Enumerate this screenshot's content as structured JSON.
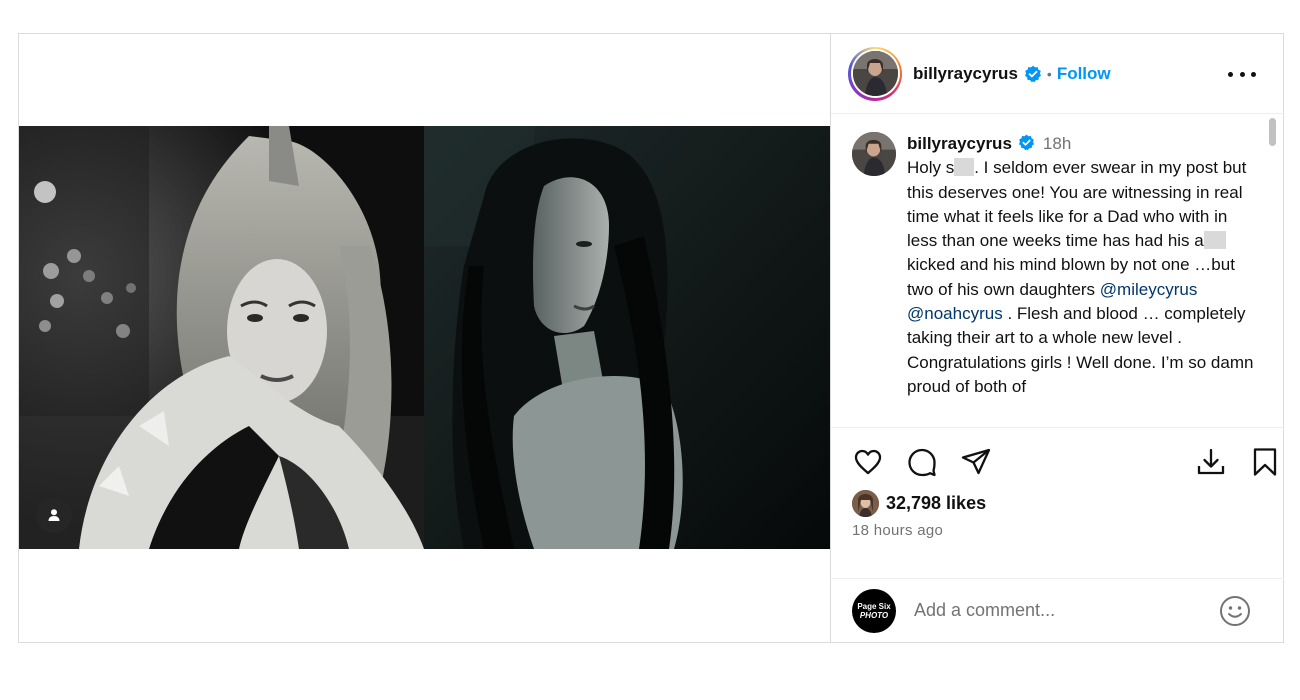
{
  "post": {
    "author": "billyraycyrus",
    "follow_label": "Follow",
    "dot": "•"
  },
  "caption": {
    "username": "billyraycyrus",
    "time": "18h",
    "seg1": "Holy s",
    "seg2": ". I seldom ever swear in my post but this deserves one! You are witnessing in real time what it feels like for a Dad who with in less than one weeks time has had his a",
    "seg3": "kicked and his mind blown by not one …but two of his own daughters",
    "mention1": "@mileycyrus",
    "mention2": "@noahcyrus",
    "seg4": ". Flesh and blood … completely taking their art to a whole new level . Congratulations girls ! Well done.  I’m so damn proud of both of"
  },
  "stats": {
    "likes": "32,798 likes",
    "time_ago": "18 hours ago"
  },
  "comment": {
    "placeholder": "Add a comment...",
    "avatar_line1": "Page Six",
    "avatar_line2": "PHOTO"
  },
  "icons": {
    "like": "heart-icon",
    "comment": "comment-bubble-icon",
    "share": "paper-plane-icon",
    "download": "download-icon",
    "save": "bookmark-icon",
    "more": "more-options-icon",
    "verified": "verified-badge-icon",
    "tag": "user-tag-icon",
    "emoji": "emoji-smile-icon"
  },
  "colors": {
    "accent": "#0095f6",
    "mention": "#00376b",
    "muted": "#737373",
    "border": "#dbdbdb"
  }
}
